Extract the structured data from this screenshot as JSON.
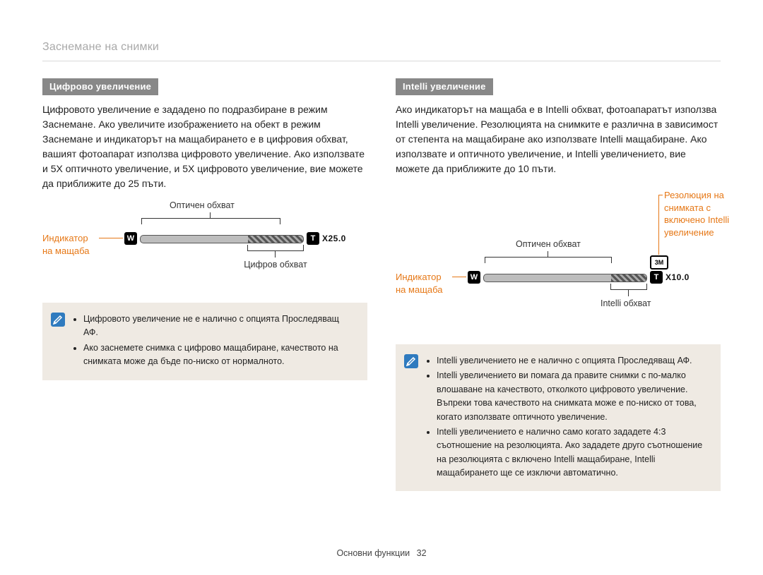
{
  "page_title": "Заснемане на снимки",
  "left": {
    "heading": "Цифрово увеличение",
    "body": "Цифровото увеличение е зададено по подразбиране в режим Заснемане. Ако увеличите изображението на обект в режим Заснемане и индикаторът на мащабирането е в цифровия обхват, вашият фотоапарат използва цифровото увеличение. Ако използвате и 5X оптичното увеличение, и 5X цифровото увеличение, вие можете да приближите до 25 пъти.",
    "diagram": {
      "w": "W",
      "t": "T",
      "zoom_value": "X25.0",
      "optical_label": "Оптичен обхват",
      "digital_label": "Цифров обхват",
      "indicator_label": "Индикатор на мащаба"
    },
    "notes": [
      "Цифровото увеличение не е налично с опцията Проследяващ АФ.",
      "Ако заснемете снимка с цифрово мащабиране, качеството на снимката може да бъде по-ниско от нормалното."
    ]
  },
  "right": {
    "heading": "Intelli увеличение",
    "body": "Ако индикаторът на мащаба е в Intelli обхват, фотоапаратът използва Intelli увеличение. Резолюцията на снимките е различна в зависимост от степента на мащабиране ако използвате Intelli мащабиране. Ако използвате и оптичното увеличение, и Intelli увеличението, вие можете да приближите до 10 пъти.",
    "diagram": {
      "w": "W",
      "t": "T",
      "zoom_value": "X10.0",
      "badge": "3M",
      "optical_label": "Оптичен обхват",
      "intelli_label": "Intelli обхват",
      "indicator_label": "Индикатор на мащаба",
      "resolution_label": "Резолюция на снимката с включено Intelli увеличение"
    },
    "notes": [
      "Intelli увеличението не е налично с опцията Проследяващ АФ.",
      "Intelli увеличението ви помага да правите снимки с по-малко влошаване на качеството, отколкото цифровото увеличение. Въпреки това качеството на снимката може е по-ниско от това, когато използвате оптичното увеличение.",
      "Intelli увеличението е налично само когато зададете 4:3 съотношение на резолюцията. Ако зададете друго съотношение на резолюцията с включено Intelli мащабиране, Intelli мащабирането ще се изключи автоматично."
    ]
  },
  "footer": {
    "section": "Основни функции",
    "page": "32"
  }
}
